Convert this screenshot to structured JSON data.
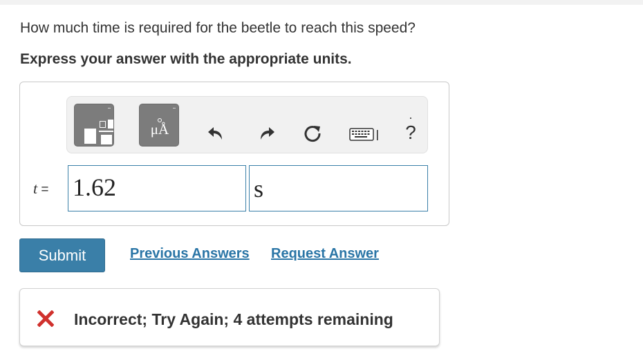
{
  "question": "How much time is required for the beetle to reach this speed?",
  "instruction": "Express your answer with the appropriate units.",
  "toolbar": {
    "templates_icon": "templates-icon",
    "units_icon": "units-icon",
    "units_glyph": "μÅ",
    "undo_icon": "undo-icon",
    "redo_icon": "redo-icon",
    "reset_icon": "reset-icon",
    "keyboard_icon": "keyboard-shortcuts-icon",
    "help_label": "?"
  },
  "answer": {
    "variable": "t",
    "equals": "=",
    "value": "1.62",
    "unit": "s"
  },
  "actions": {
    "submit_label": "Submit",
    "previous_answers_label": "Previous Answers",
    "request_answer_label": "Request Answer"
  },
  "feedback": {
    "icon": "incorrect-x-icon",
    "message": "Incorrect; Try Again; 4 attempts remaining"
  },
  "colors": {
    "accent": "#3a7fa8",
    "link": "#2a75a6",
    "error": "#d0312d",
    "toolbar_button": "#7c7c7c"
  }
}
